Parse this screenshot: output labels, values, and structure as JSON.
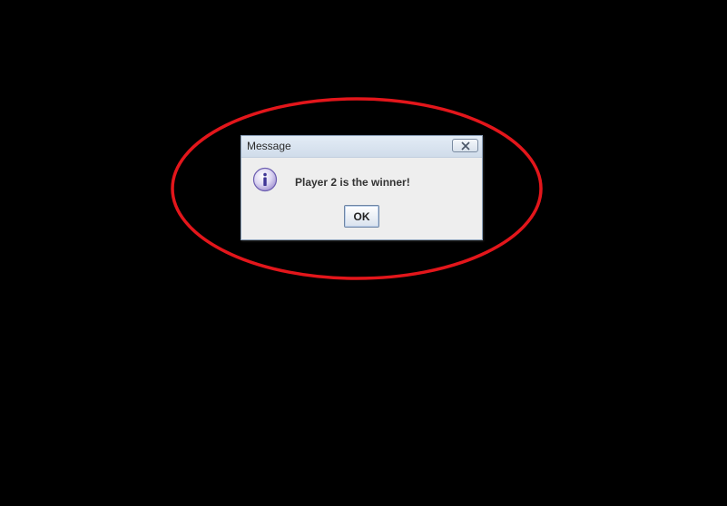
{
  "dialog": {
    "title": "Message",
    "message": "Player 2 is the winner!",
    "ok_label": "OK",
    "icon": "info-icon",
    "close_icon": "close-icon"
  },
  "annotation": {
    "color": "#e3161b"
  }
}
